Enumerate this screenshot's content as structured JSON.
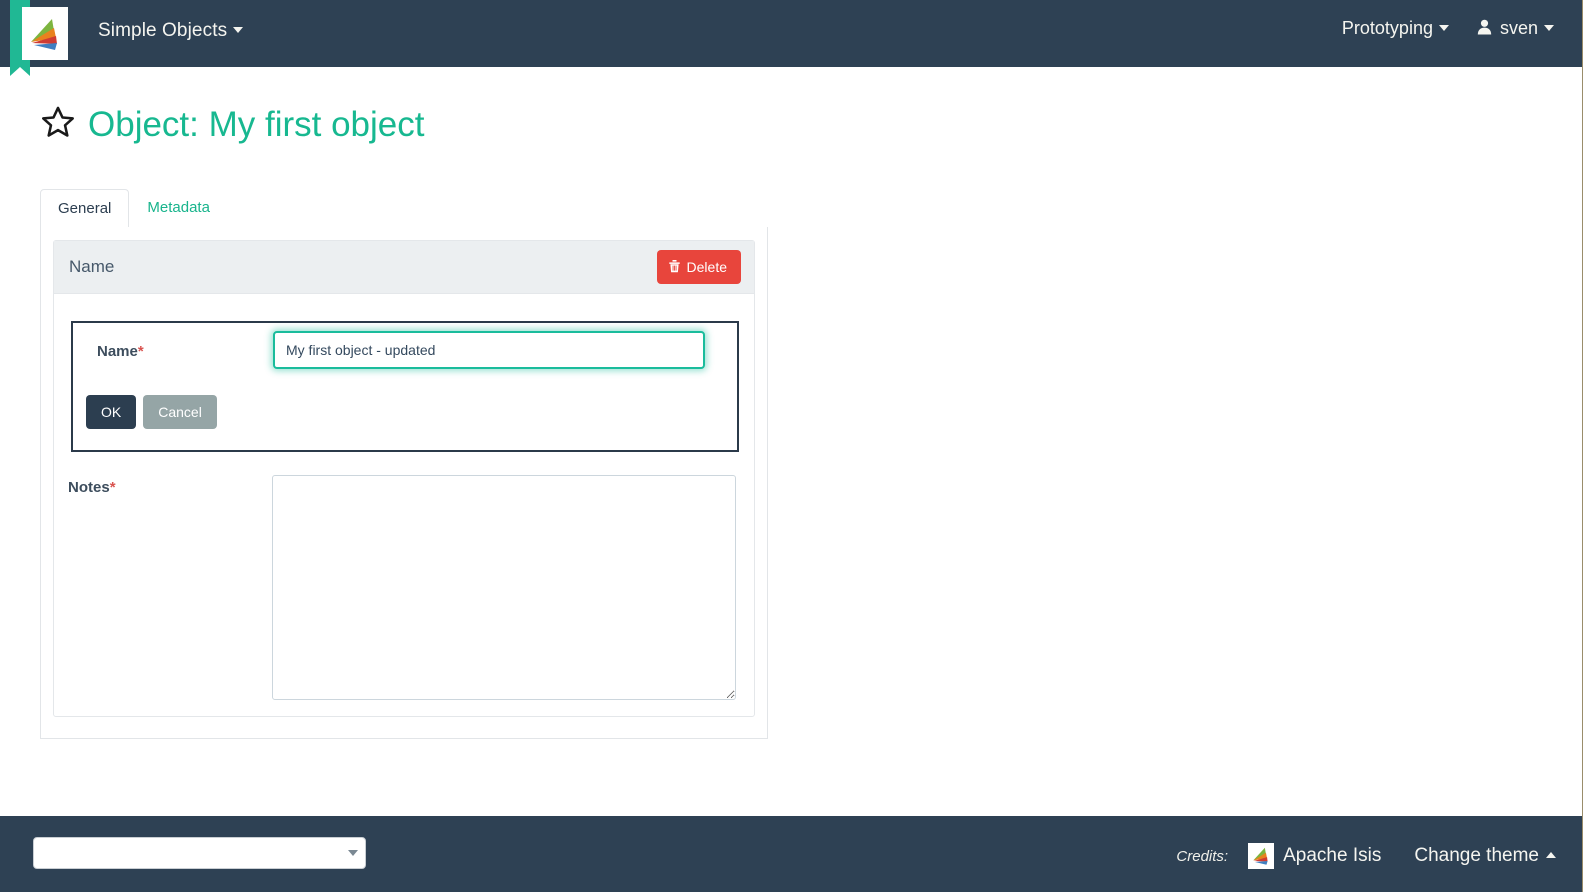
{
  "header": {
    "logo_icon": "apache-isis-fan-logo",
    "brand_label": "Simple Objects",
    "brand_caret_icon": "caret-down-icon",
    "menu_label": "Prototyping",
    "menu_caret_icon": "caret-down-icon",
    "user_icon": "user-icon",
    "user_label": "sven",
    "user_caret_icon": "caret-down-icon",
    "accent_color": "#20b894",
    "background_color": "#2e4154"
  },
  "page": {
    "bookmark_icon": "star-outline-icon",
    "title": "Object: My first object",
    "title_color": "#17b890"
  },
  "tabs": [
    {
      "label": "General",
      "active": true
    },
    {
      "label": "Metadata",
      "active": false
    }
  ],
  "card": {
    "header_title": "Name",
    "delete_button": {
      "label": "Delete",
      "icon": "trash-icon",
      "color": "#e8453c"
    }
  },
  "form": {
    "name_field": {
      "label": "Name",
      "required_marker": "*",
      "value": "My first object - updated",
      "placeholder": "",
      "focused": true,
      "focus_color": "#1abc9c"
    },
    "ok_button": {
      "label": "OK",
      "color": "#2c3e50"
    },
    "cancel_button": {
      "label": "Cancel",
      "color": "#95a5a6"
    },
    "notes_field": {
      "label": "Notes",
      "required_marker": "*",
      "value": "",
      "placeholder": ""
    }
  },
  "footer": {
    "theme_select_value": "",
    "select_caret_icon": "caret-down-icon",
    "credits_label": "Credits:",
    "credits_logo_icon": "apache-isis-fan-logo",
    "credits_link": "Apache Isis",
    "change_theme_label": "Change theme",
    "change_theme_caret_icon": "caret-up-icon",
    "background_color": "#2e4154"
  }
}
